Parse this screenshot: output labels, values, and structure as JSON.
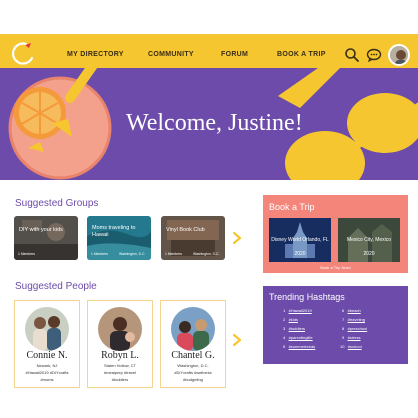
{
  "nav": {
    "items": [
      "MY DIRECTORY",
      "COMMUNITY",
      "FORUM",
      "BOOK A TRIP"
    ],
    "icons": [
      "search-icon",
      "chat-icon"
    ]
  },
  "hero": {
    "title": "Welcome, Justine!"
  },
  "groups": {
    "title": "Suggested Groups",
    "cards": [
      {
        "caption": "DIY with your kids",
        "sub": "1 Members"
      },
      {
        "caption": "Moms traveling to Hawaii",
        "sub": "1 Members"
      },
      {
        "caption": "Vinyl Book Club",
        "sub": "1 Members"
      }
    ],
    "card_subs_right": [
      "",
      "Washington, D.C.",
      "Washington, D.C."
    ]
  },
  "trip": {
    "title": "Book a Trip",
    "cards": [
      {
        "caption": "Disney World Orlando, FL",
        "year": "2020"
      },
      {
        "caption": "Mexico City, Mexico",
        "year": "2020"
      }
    ],
    "link": "Book a Trip Now!"
  },
  "people": {
    "title": "Suggested People",
    "cards": [
      {
        "name": "Connie N.",
        "location": "Newark, NJ",
        "tags": "#Hawaii2019 #DIYcrafts",
        "tags2": "#moms"
      },
      {
        "name": "Robyn L.",
        "location": "Staten Hollow, CT",
        "tags": "#mealprep #travel",
        "tags2": "#toddlers"
      },
      {
        "name": "Chantel G.",
        "location": "Washington, D.C.",
        "tags": "#DIYcrafts #wellness",
        "tags2": "#budgeting"
      }
    ]
  },
  "trending": {
    "title": "Trending Hashtags",
    "left": [
      {
        "n": "1",
        "tag": "#Hawaii2019"
      },
      {
        "n": "2",
        "tag": "#kids"
      },
      {
        "n": "3",
        "tag": "#toddlers"
      },
      {
        "n": "4",
        "tag": "#parentinglife"
      },
      {
        "n": "5",
        "tag": "#summerbreak"
      }
    ],
    "right": [
      {
        "n": "6",
        "tag": "#beach"
      },
      {
        "n": "7",
        "tag": "#traveling"
      },
      {
        "n": "8",
        "tag": "#preschool"
      },
      {
        "n": "9",
        "tag": "#stress"
      },
      {
        "n": "10",
        "tag": "#school"
      }
    ]
  },
  "colors": {
    "header": "#f6c630",
    "purple": "#6c4bab",
    "coral": "#f3857a"
  }
}
